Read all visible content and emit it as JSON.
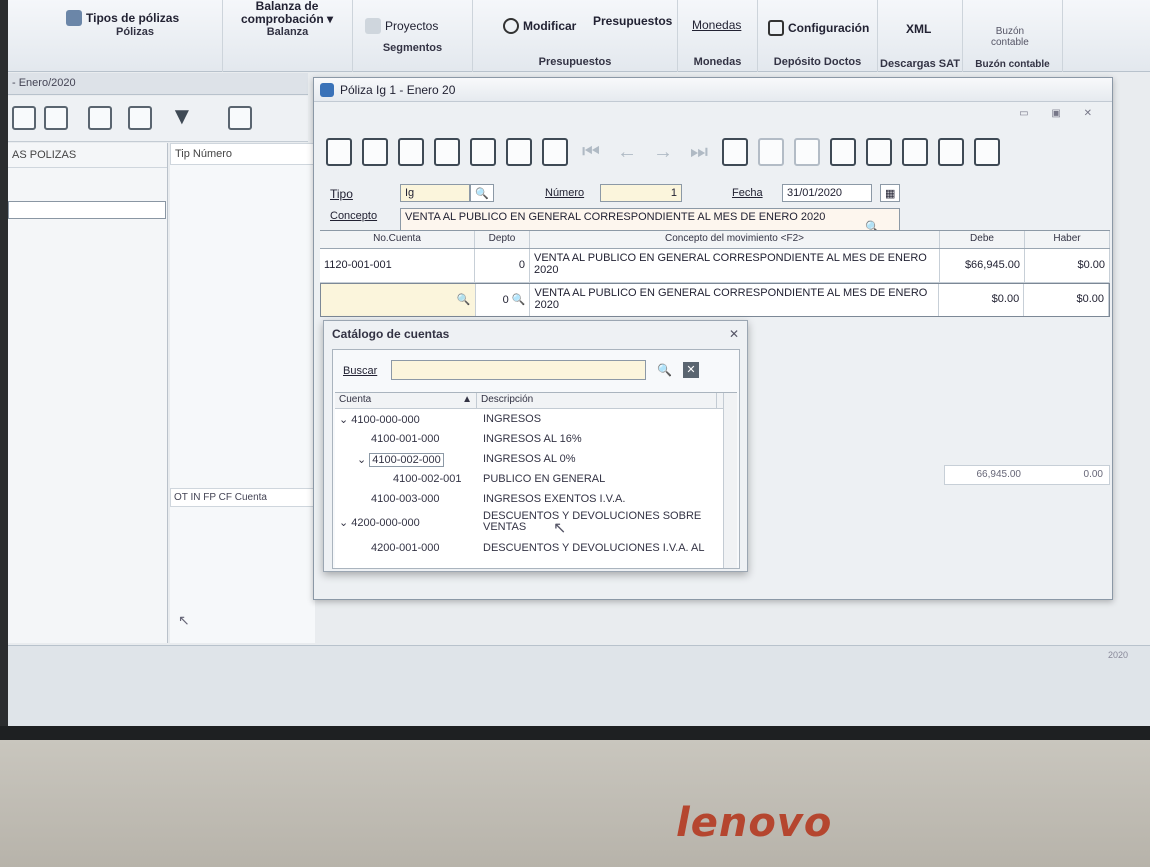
{
  "ribbon": {
    "polizas": {
      "btn": "Tipos de pólizas",
      "label": "Pólizas"
    },
    "balanza": {
      "btn_line1": "Balanza de",
      "btn_line2": "comprobación ▾",
      "label": "Balanza"
    },
    "segmentos": {
      "btn": "Proyectos",
      "label": "Segmentos"
    },
    "presupuestos": {
      "btn_modificar": "Modificar",
      "btn_presupuestos": "Presupuestos",
      "label": "Presupuestos"
    },
    "monedas": {
      "btn": "Monedas",
      "label": "Monedas"
    },
    "deposito": {
      "btn": "Configuración",
      "label": "Depósito Doctos"
    },
    "descargas": {
      "btn": "XML",
      "label": "Descargas SAT"
    },
    "buzon": {
      "btn_line1": "Buzón",
      "btn_line2": "contable",
      "label": "Buzón contable"
    }
  },
  "doc_tab": "- Enero/2020",
  "left_panel": {
    "header": "AS POLIZAS"
  },
  "mid_panel": {
    "header": "Tip Número",
    "header2": "OT IN FP CF Cuenta"
  },
  "status_right": "2020",
  "window": {
    "title": "Póliza Ig   1 - Enero 20",
    "form": {
      "tipo_label": "Tipo",
      "tipo_value": "Ig",
      "numero_label": "Número",
      "numero_value": "1",
      "fecha_label": "Fecha",
      "fecha_value": "31/01/2020",
      "concepto_label": "Concepto",
      "concepto_value": "VENTA AL PUBLICO EN GENERAL CORRESPONDIENTE AL  MES DE ENERO 2020"
    },
    "grid": {
      "headers": [
        "No.Cuenta",
        "Depto",
        "Concepto del movimiento <F2>",
        "Debe",
        "Haber"
      ],
      "rows": [
        {
          "cuenta": "1120-001-001",
          "depto": "0",
          "concepto": "VENTA AL PUBLICO EN GENERAL CORRESPONDIENTE AL  MES DE ENERO 2020",
          "debe": "$66,945.00",
          "haber": "$0.00"
        },
        {
          "cuenta": "",
          "depto": "0",
          "concepto": "VENTA AL PUBLICO EN GENERAL CORRESPONDIENTE AL  MES DE ENERO 2020",
          "debe": "$0.00",
          "haber": "$0.00"
        }
      ],
      "totals": {
        "debe": "66,945.00",
        "haber": "0.00"
      }
    }
  },
  "catalog": {
    "title": "Catálogo de cuentas",
    "buscar_label": "Buscar",
    "buscar_value": "",
    "col_cuenta": "Cuenta",
    "col_descripcion": "Descripción",
    "rows": [
      {
        "cuenta": "4100-000-000",
        "desc": "INGRESOS",
        "level": 0,
        "expander": "⌄"
      },
      {
        "cuenta": "4100-001-000",
        "desc": "INGRESOS AL 16%",
        "level": 1,
        "expander": ""
      },
      {
        "cuenta": "4100-002-000",
        "desc": "INGRESOS AL 0%",
        "level": 1,
        "expander": "⌄"
      },
      {
        "cuenta": "4100-002-001",
        "desc": "PUBLICO EN GENERAL",
        "level": 2,
        "expander": ""
      },
      {
        "cuenta": "4100-003-000",
        "desc": "INGRESOS EXENTOS I.V.A.",
        "level": 1,
        "expander": ""
      },
      {
        "cuenta": "4200-000-000",
        "desc": "DESCUENTOS Y DEVOLUCIONES SOBRE VENTAS",
        "level": 0,
        "expander": "⌄"
      },
      {
        "cuenta": "4200-001-000",
        "desc": "DESCUENTOS Y DEVOLUCIONES I.V.A. AL",
        "level": 1,
        "expander": ""
      }
    ]
  },
  "bezel_brand": "lenovo",
  "colors": {
    "accent": "#3a72b8",
    "brand": "#b5462f"
  }
}
